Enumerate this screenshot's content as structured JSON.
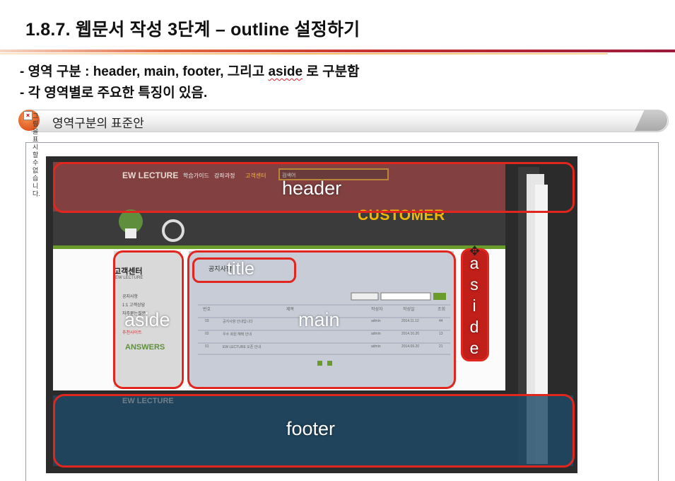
{
  "title": "1.8.7. 웹문서 작성 3단계 – outline 설정하기",
  "bullets": [
    {
      "dash": "- ",
      "text_a": "영역 구분 : header, main, footer, 그리고 ",
      "squiggle": "aside",
      "text_b": " 로 구분함"
    },
    {
      "dash": "- ",
      "text_a": "각 영역별로 주요한 특징이 있음.",
      "squiggle": "",
      "text_b": ""
    }
  ],
  "banner": {
    "label": "영역구분의 표준안"
  },
  "broken_image": {
    "icon": "broken-image-icon",
    "text": "그림을표시할수없습니다."
  },
  "screenshot": {
    "site": {
      "logo": "EW LECTURE",
      "nav": [
        "학습가이드",
        "강좌과정",
        "고객센터"
      ],
      "search_placeholder": "검색어",
      "hero": "CUSTOMER",
      "aside_title": "고객센터",
      "aside_sub": "EW LECTURE",
      "aside_items": [
        "공지사항",
        "1:1 고객상담",
        "자주묻는질문",
        "추천사이트"
      ],
      "aside_logo": "ANSWERS",
      "main_title": "공지사항",
      "table_headers": [
        "번호",
        "제목",
        "작성자",
        "작성일",
        "조회"
      ],
      "rows": [
        [
          "03",
          "공지사항 안내입니다",
          "admin",
          "2014.11.12",
          "44"
        ],
        [
          "02",
          "우수 회원 혜택 안내",
          "admin",
          "2014.10.20",
          "13"
        ],
        [
          "01",
          "EW LECTURE 오픈 안내",
          "admin",
          "2014.09.20",
          "21"
        ]
      ],
      "footer_logo": "EW LECTURE"
    },
    "labels": {
      "header": "header",
      "title": "title",
      "aside_left": "aside",
      "main": "main",
      "aside_right": "aside",
      "footer": "footer"
    },
    "colors": {
      "outline": "#e0261e",
      "header_tint": "#7a2a2a",
      "footer_tint": "#1f4a66",
      "site_green": "#6a9c2b"
    }
  }
}
